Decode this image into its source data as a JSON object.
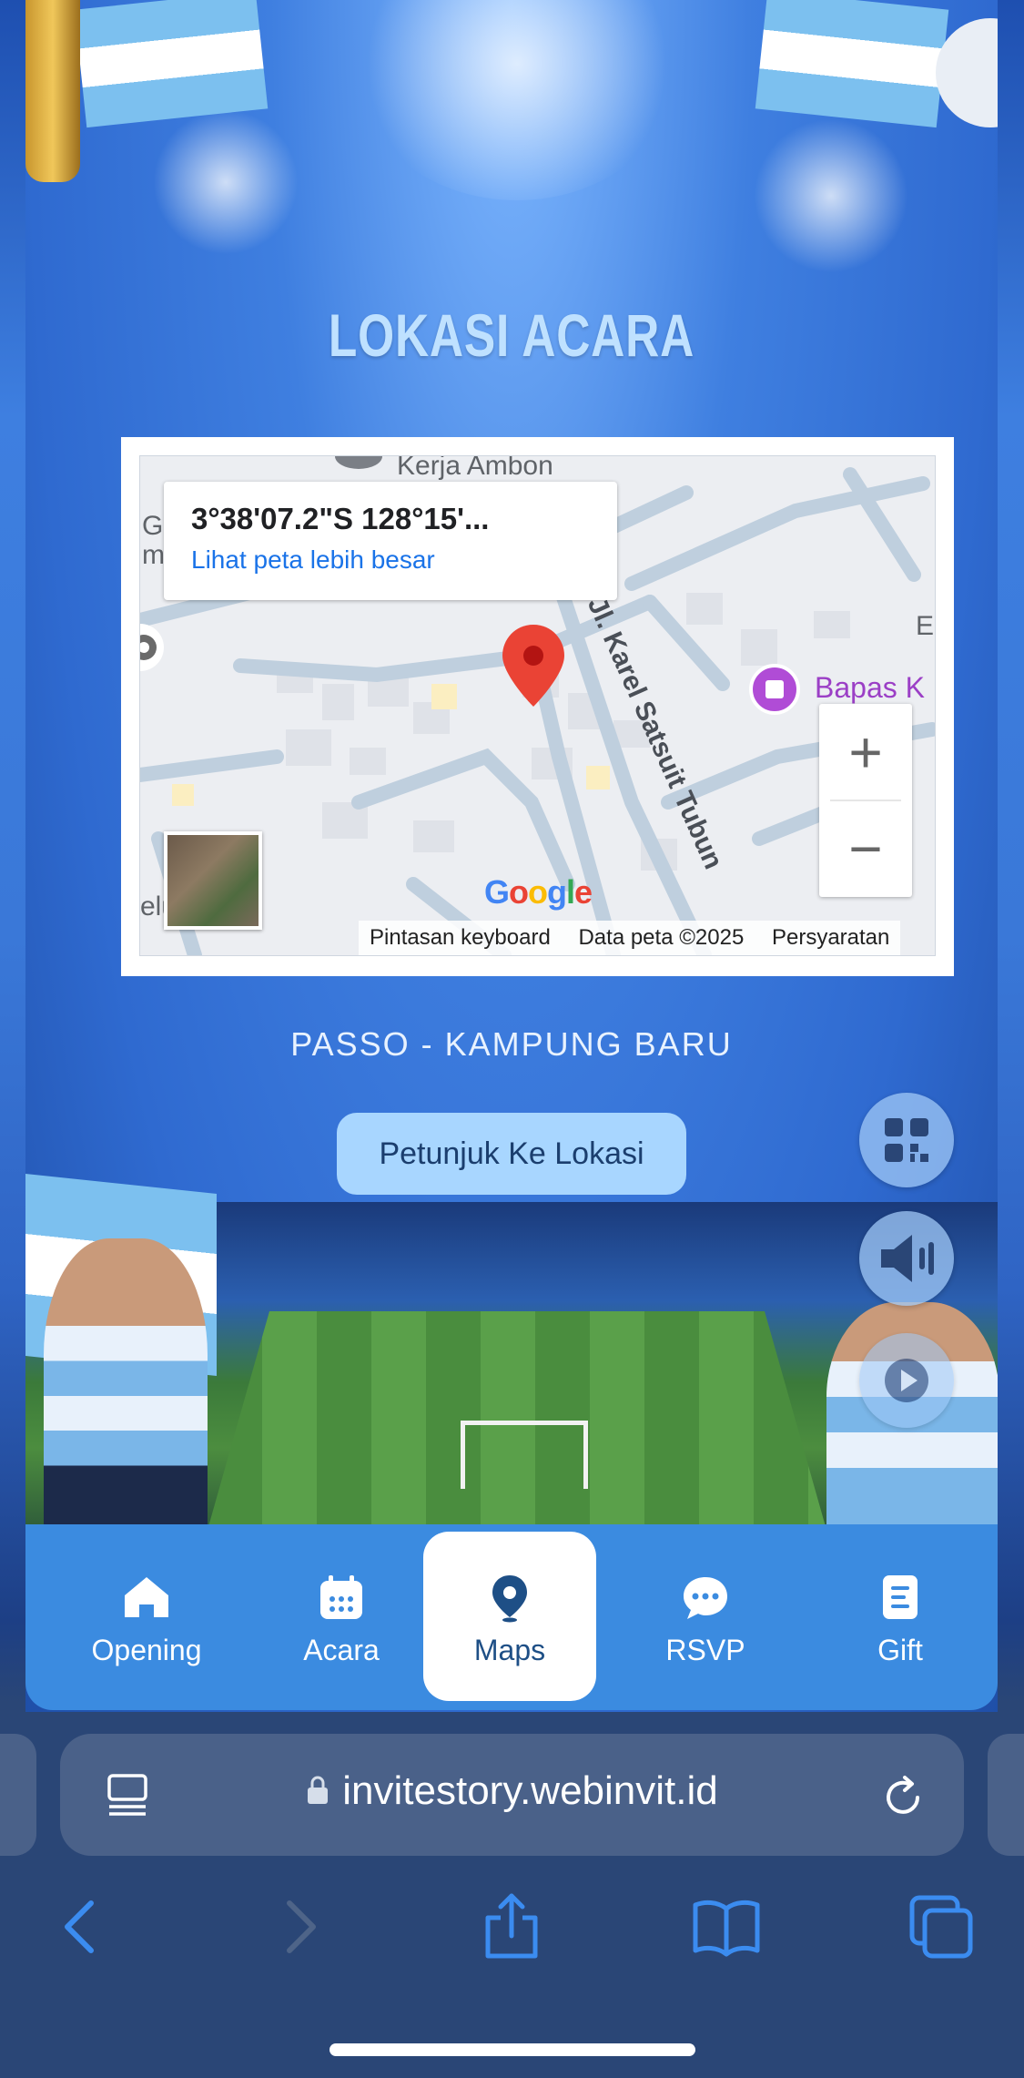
{
  "section": {
    "title": "LOKASI ACARA",
    "location_name": "PASSO - KAMPUNG BARU",
    "directions_button": "Petunjuk Ke Lokasi"
  },
  "map": {
    "coordinates": "3°38'07.2\"S 128°15'...",
    "bigger_map_link": "Lihat peta lebih besar",
    "labels": {
      "top_place": "Kerja Ambon",
      "street": "Jl. Karel Satsuit Tubun",
      "poi": "Bapas K",
      "edge_g": "G",
      "edge_m": "m",
      "edge_e": "E",
      "edge_el": "elu"
    },
    "zoom_in": "+",
    "zoom_out": "−",
    "google_logo": "Google",
    "attribution": {
      "shortcuts": "Pintasan keyboard",
      "data": "Data peta ©2025",
      "terms": "Persyaratan"
    }
  },
  "floating_buttons": [
    "qr-code-icon",
    "speaker-icon",
    "play-icon"
  ],
  "bottom_nav": {
    "items": [
      {
        "label": "Opening",
        "icon": "home-icon"
      },
      {
        "label": "Acara",
        "icon": "calendar-icon"
      },
      {
        "label": "Maps",
        "icon": "map-pin-icon",
        "active": true
      },
      {
        "label": "RSVP",
        "icon": "chat-icon"
      },
      {
        "label": "Gift",
        "icon": "gift-icon"
      }
    ]
  },
  "browser": {
    "url": "invitestory.webinvit.id",
    "toolbar": [
      "back-icon",
      "forward-icon",
      "share-icon",
      "bookmarks-icon",
      "tabs-icon"
    ]
  },
  "colors": {
    "accent": "#3b8be0",
    "nav_active_text": "#1e4f86",
    "button_bg": "#a8d6ff",
    "pin_red": "#ea4335",
    "link_blue": "#1a73e8"
  }
}
